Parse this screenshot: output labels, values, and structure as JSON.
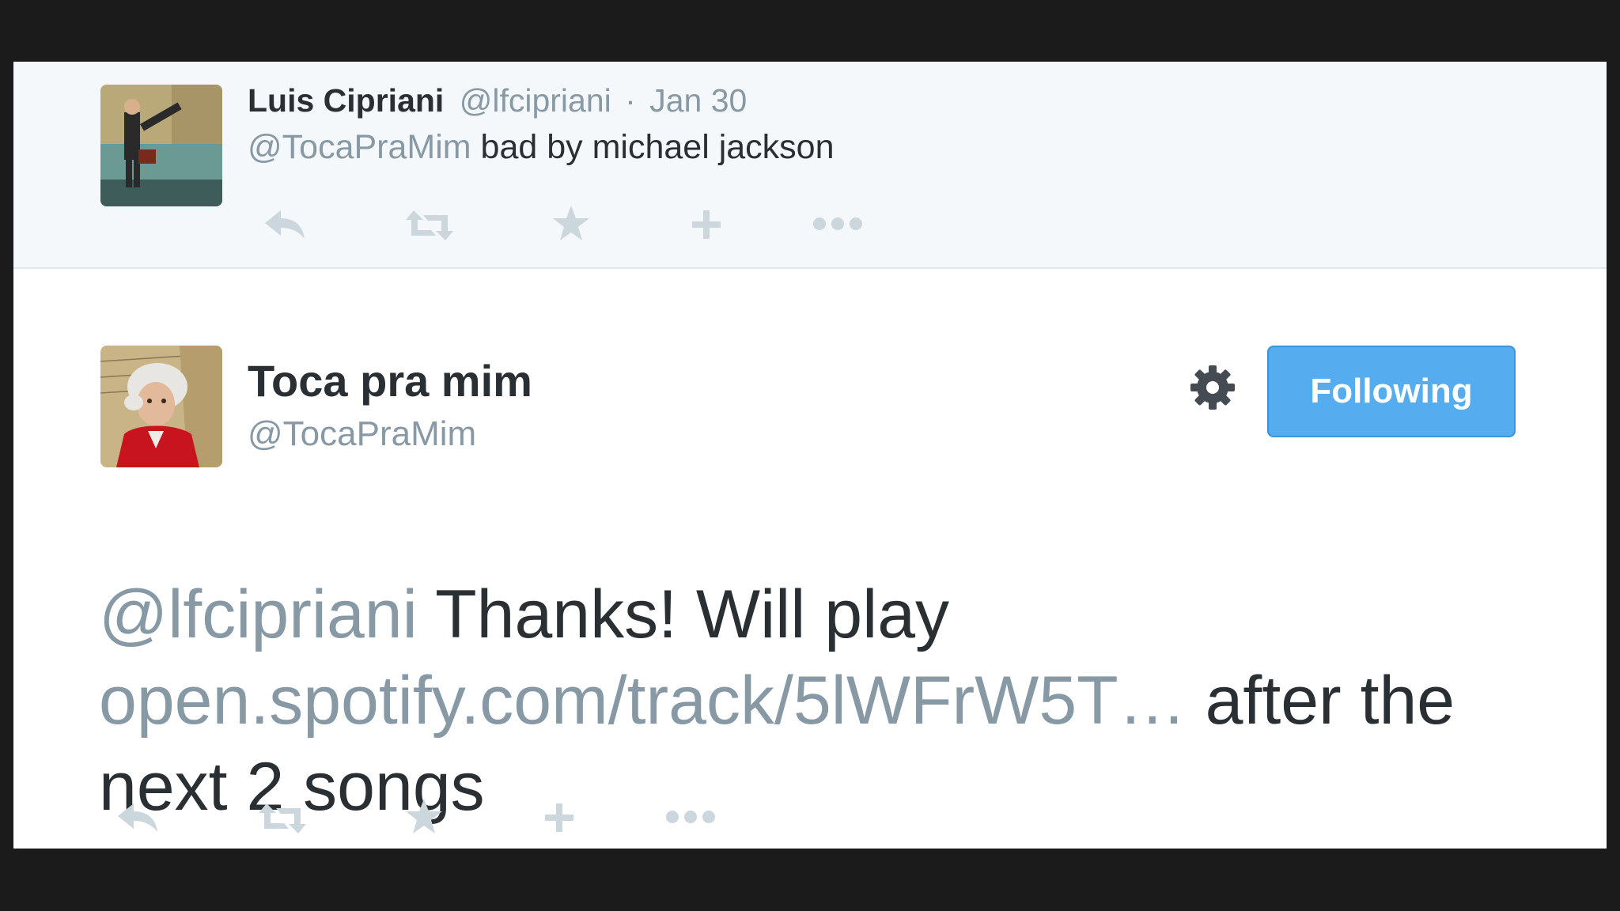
{
  "reply_tweet": {
    "author_name": "Luis Cipriani",
    "author_handle": "@lfcipriani",
    "separator": "·",
    "date": "Jan 30",
    "mention": "@TocaPraMim",
    "text": " bad by michael jackson",
    "actions": [
      "reply-icon",
      "retweet-icon",
      "favorite-star-icon",
      "add-icon",
      "more-dots-icon"
    ]
  },
  "main_tweet": {
    "author_name": "Toca pra mim",
    "author_handle": "@TocaPraMim",
    "follow_button_label": "Following",
    "mention": "@lfcipriani",
    "text_part1": " Thanks! Will play ",
    "link": "open.spotify.com/track/5lWFrW5T…",
    "text_part2": " after the next 2 songs",
    "actions": [
      "reply-icon",
      "retweet-icon",
      "favorite-star-icon",
      "add-icon",
      "more-dots-icon"
    ]
  },
  "colors": {
    "background": "#1b1b1b",
    "reply_background": "#f5f8fa",
    "text": "#292f33",
    "muted": "#8899a6",
    "action_icons": "#ccd6dd",
    "follow_button": "#55acee"
  }
}
